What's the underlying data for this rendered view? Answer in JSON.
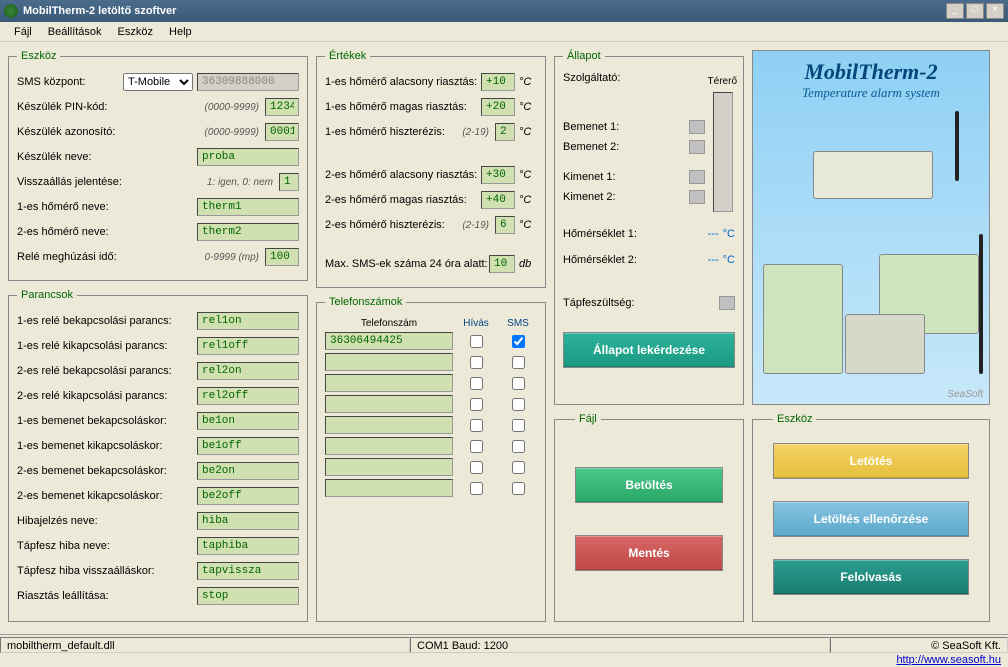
{
  "window": {
    "title": "MobilTherm-2 letöltő szoftver"
  },
  "menu": {
    "file": "Fájl",
    "settings": "Beállítások",
    "tool": "Eszköz",
    "help": "Help"
  },
  "eszkoz": {
    "legend": "Eszköz",
    "sms_kozpont_lbl": "SMS központ:",
    "sms_kozpont_sel": "T-Mobile",
    "sms_kozpont_num": "36309888000",
    "pin_lbl": "Készülék PIN-kód:",
    "pin_hint": "(0000-9999)",
    "pin": "1234",
    "azonosito_lbl": "Készülék azonosító:",
    "azonosito_hint": "(0000-9999)",
    "azonosito": "0001",
    "nev_lbl": "Készülék neve:",
    "nev": "proba",
    "vissza_lbl": "Visszaállás jelentése:",
    "vissza_hint": "1: igen, 0: nem",
    "vissza": "1",
    "h1_lbl": "1-es hőmérő neve:",
    "h1": "therm1",
    "h2_lbl": "2-es hőmérő neve:",
    "h2": "therm2",
    "rele_lbl": "Relé meghúzási idő:",
    "rele_hint": "0-9999 (mp)",
    "rele": "100"
  },
  "parancsok": {
    "legend": "Parancsok",
    "r1on_lbl": "1-es relé bekapcsolási parancs:",
    "r1on": "rel1on",
    "r1off_lbl": "1-es relé kikapcsolási parancs:",
    "r1off": "rel1off",
    "r2on_lbl": "2-es relé bekapcsolási parancs:",
    "r2on": "rel2on",
    "r2off_lbl": "2-es relé kikapcsolási parancs:",
    "r2off": "rel2off",
    "b1on_lbl": "1-es bemenet bekapcsoláskor:",
    "b1on": "be1on",
    "b1off_lbl": "1-es bemenet kikapcsoláskor:",
    "b1off": "be1off",
    "b2on_lbl": "2-es bemenet bekapcsoláskor:",
    "b2on": "be2on",
    "b2off_lbl": "2-es bemenet kikapcsoláskor:",
    "b2off": "be2off",
    "hiba_lbl": "Hibajelzés neve:",
    "hiba": "hiba",
    "taphiba_lbl": "Tápfesz hiba neve:",
    "taphiba": "taphiba",
    "tapvissza_lbl": "Tápfesz hiba visszaálláskor:",
    "tapvissza": "tapvissza",
    "stop_lbl": "Riasztás leállítása:",
    "stop": "stop"
  },
  "ertekek": {
    "legend": "Értékek",
    "h1low_lbl": "1-es hőmérő alacsony riasztás:",
    "h1low": "+10",
    "h1high_lbl": "1-es hőmérő magas riasztás:",
    "h1high": "+20",
    "h1hist_lbl": "1-es hőmérő hiszterézis:",
    "h1hist_hint": "(2-19)",
    "h1hist": "2",
    "h2low_lbl": "2-es hőmérő alacsony riasztás:",
    "h2low": "+30",
    "h2high_lbl": "2-es hőmérő magas riasztás:",
    "h2high": "+40",
    "h2hist_lbl": "2-es hőmérő hiszterézis:",
    "h2hist_hint": "(2-19)",
    "h2hist": "6",
    "maxsms_lbl": "Max. SMS-ek száma 24 óra alatt:",
    "maxsms": "10",
    "celsius": "°C",
    "db": "db"
  },
  "telefon": {
    "legend": "Telefonszámok",
    "col_phone": "Telefonszám",
    "col_call": "Hívás",
    "col_sms": "SMS",
    "rows": [
      {
        "num": "36306494425",
        "call": false,
        "sms": true
      },
      {
        "num": "",
        "call": false,
        "sms": false
      },
      {
        "num": "",
        "call": false,
        "sms": false
      },
      {
        "num": "",
        "call": false,
        "sms": false
      },
      {
        "num": "",
        "call": false,
        "sms": false
      },
      {
        "num": "",
        "call": false,
        "sms": false
      },
      {
        "num": "",
        "call": false,
        "sms": false
      },
      {
        "num": "",
        "call": false,
        "sms": false
      }
    ]
  },
  "allapot": {
    "legend": "Állapot",
    "szolg_lbl": "Szolgáltató:",
    "terero_lbl": "Térerő",
    "be1_lbl": "Bemenet 1:",
    "be2_lbl": "Bemenet 2:",
    "ki1_lbl": "Kimenet 1:",
    "ki2_lbl": "Kimenet 2:",
    "t1_lbl": "Hőmérséklet 1:",
    "t1_val": "---",
    "t1_unit": "°C",
    "t2_lbl": "Hőmérséklet 2:",
    "t2_val": "---",
    "t2_unit": "°C",
    "tap_lbl": "Tápfeszültség:",
    "query_btn": "Állapot lekérdezése"
  },
  "fajl": {
    "legend": "Fájl",
    "load": "Betöltés",
    "save": "Mentés"
  },
  "toolbox": {
    "legend": "Eszköz",
    "download": "Letötés",
    "verify": "Letöltés ellenőrzése",
    "read": "Felolvasás"
  },
  "product": {
    "title": "MobilTherm-2",
    "subtitle": "Temperature alarm system",
    "brand": "SeaSoft"
  },
  "status": {
    "file": "mobiltherm_default.dll",
    "com": "COM1 Baud: 1200",
    "copyright": "© SeaSoft Kft.",
    "link": "http://www.seasoft.hu"
  }
}
